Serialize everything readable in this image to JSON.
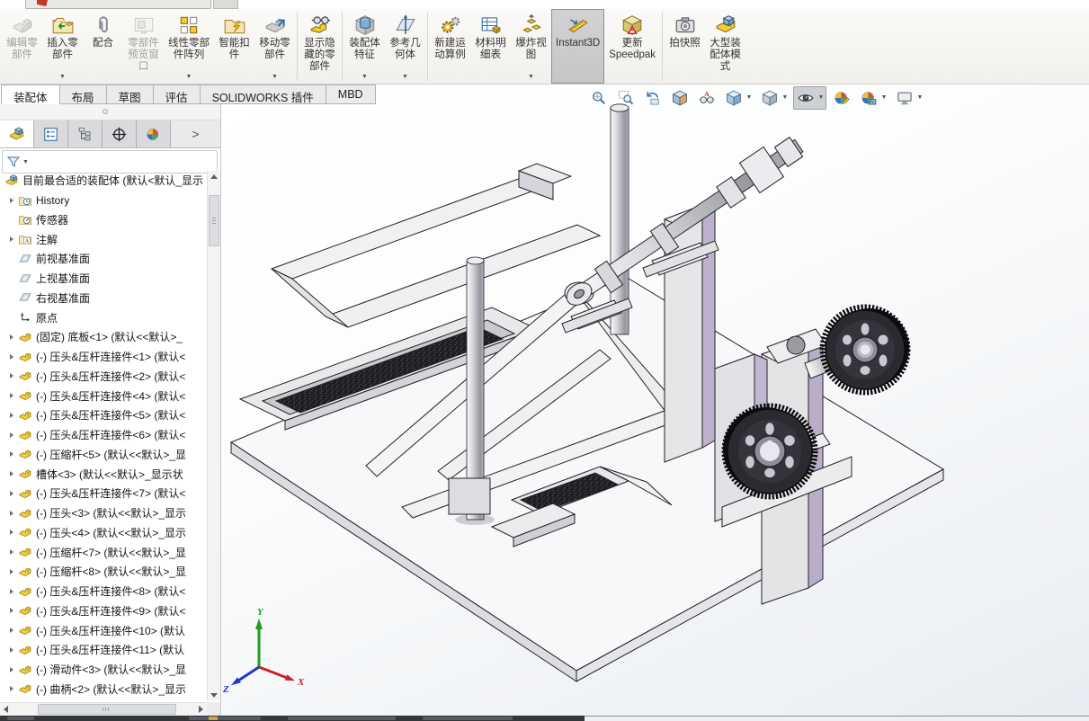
{
  "ribbon": {
    "items": [
      {
        "icon": "edit-component-icon",
        "label": "编辑零\n部件",
        "disabled": true
      },
      {
        "icon": "insert-component-icon",
        "label": "插入零\n部件",
        "dropdown": true
      },
      {
        "icon": "mate-icon",
        "label": "配合"
      },
      {
        "icon": "component-preview-icon",
        "label": "零部件\n预览窗\n口",
        "disabled": true
      },
      {
        "icon": "linear-pattern-icon",
        "label": "线性零部\n件阵列",
        "dropdown": true
      },
      {
        "icon": "smart-fasteners-icon",
        "label": "智能扣\n件"
      },
      {
        "icon": "move-component-icon",
        "label": "移动零\n部件",
        "dropdown": true
      },
      {
        "sep": true
      },
      {
        "icon": "show-hidden-components-icon",
        "label": "显示隐\n藏的零\n部件"
      },
      {
        "sep": true
      },
      {
        "icon": "assembly-features-icon",
        "label": "装配体\n特征",
        "dropdown": true
      },
      {
        "icon": "reference-geometry-icon",
        "label": "参考几\n何体",
        "dropdown": true
      },
      {
        "sep": true
      },
      {
        "icon": "motion-study-icon",
        "label": "新建运\n动算例"
      },
      {
        "icon": "bom-icon",
        "label": "材料明\n细表"
      },
      {
        "icon": "exploded-view-icon",
        "label": "爆炸视\n图",
        "dropdown": true
      },
      {
        "icon": "instant3d-icon",
        "label": "Instant3D",
        "active": true
      },
      {
        "icon": "update-speedpak-icon",
        "label": "更新\nSpeedpak"
      },
      {
        "sep": true
      },
      {
        "icon": "snapshot-icon",
        "label": "拍快照"
      },
      {
        "icon": "large-assembly-mode-icon",
        "label": "大型装\n配体模\n式"
      }
    ]
  },
  "tabs": {
    "items": [
      {
        "label": "装配体",
        "active": true
      },
      {
        "label": "布局"
      },
      {
        "label": "草图"
      },
      {
        "label": "评估"
      },
      {
        "label": "SOLIDWORKS 插件"
      },
      {
        "label": "MBD"
      }
    ]
  },
  "headsup": {
    "items": [
      {
        "icon": "zoom-fit-icon"
      },
      {
        "icon": "zoom-area-icon"
      },
      {
        "icon": "previous-view-icon"
      },
      {
        "icon": "section-view-icon"
      },
      {
        "icon": "view-annotations-icon"
      },
      {
        "icon": "view-orientation-icon",
        "dropdown": true
      },
      {
        "icon": "display-style-icon",
        "dropdown": true
      },
      {
        "icon": "hide-show-items-icon",
        "dropdown": true,
        "active": true
      },
      {
        "icon": "edit-appearance-icon"
      },
      {
        "icon": "apply-scene-icon",
        "dropdown": true
      },
      {
        "icon": "view-settings-icon",
        "dropdown": true
      }
    ]
  },
  "panel": {
    "tabs": [
      {
        "icon": "featuremanager-tab-icon",
        "active": true
      },
      {
        "icon": "propertymanager-tab-icon"
      },
      {
        "icon": "configurationmanager-tab-icon"
      },
      {
        "icon": "dimxpertmanager-tab-icon"
      },
      {
        "icon": "displaymanager-tab-icon"
      }
    ],
    "overflow_chevron": ">",
    "filter": {
      "icon": "filter-funnel-icon",
      "dropdown": true
    }
  },
  "tree": {
    "items": [
      {
        "icon": "assembly-icon",
        "label": "目前最合适的装配体 (默认<默认_显示",
        "arrow": false,
        "root": true
      },
      {
        "icon": "history-folder-icon",
        "label": "History",
        "arrow": true
      },
      {
        "icon": "sensors-folder-icon",
        "label": "传感器",
        "arrow": false
      },
      {
        "icon": "annotations-folder-icon",
        "label": "注解",
        "arrow": true
      },
      {
        "icon": "plane-icon",
        "label": "前视基准面",
        "arrow": false
      },
      {
        "icon": "plane-icon",
        "label": "上视基准面",
        "arrow": false
      },
      {
        "icon": "plane-icon",
        "label": "右视基准面",
        "arrow": false
      },
      {
        "icon": "origin-icon",
        "label": "原点",
        "arrow": false
      },
      {
        "icon": "part-icon",
        "label": "(固定) 底板<1> (默认<<默认>_",
        "arrow": true
      },
      {
        "icon": "part-icon",
        "label": "(-) 压头&压杆连接件<1> (默认<",
        "arrow": true
      },
      {
        "icon": "part-icon",
        "label": "(-) 压头&压杆连接件<2> (默认<",
        "arrow": true
      },
      {
        "icon": "part-icon",
        "label": "(-) 压头&压杆连接件<4> (默认<",
        "arrow": true
      },
      {
        "icon": "part-icon",
        "label": "(-) 压头&压杆连接件<5> (默认<",
        "arrow": true
      },
      {
        "icon": "part-icon",
        "label": "(-) 压头&压杆连接件<6> (默认<",
        "arrow": true
      },
      {
        "icon": "part-icon",
        "label": "(-) 压缩杆<5> (默认<<默认>_显",
        "arrow": true
      },
      {
        "icon": "part-icon",
        "label": "槽体<3> (默认<<默认>_显示状",
        "arrow": true
      },
      {
        "icon": "part-icon",
        "label": "(-) 压头&压杆连接件<7> (默认<",
        "arrow": true
      },
      {
        "icon": "part-icon",
        "label": "(-) 压头<3> (默认<<默认>_显示",
        "arrow": true
      },
      {
        "icon": "part-icon",
        "label": "(-) 压头<4> (默认<<默认>_显示",
        "arrow": true
      },
      {
        "icon": "part-icon",
        "label": "(-) 压缩杆<7> (默认<<默认>_显",
        "arrow": true
      },
      {
        "icon": "part-icon",
        "label": "(-) 压缩杆<8> (默认<<默认>_显",
        "arrow": true
      },
      {
        "icon": "part-icon",
        "label": "(-) 压头&压杆连接件<8> (默认<",
        "arrow": true
      },
      {
        "icon": "part-icon",
        "label": "(-) 压头&压杆连接件<9> (默认<",
        "arrow": true
      },
      {
        "icon": "part-icon",
        "label": "(-) 压头&压杆连接件<10> (默认",
        "arrow": true
      },
      {
        "icon": "part-icon",
        "label": "(-) 压头&压杆连接件<11> (默认",
        "arrow": true
      },
      {
        "icon": "part-icon",
        "label": "(-) 滑动件<3> (默认<<默认>_显",
        "arrow": true
      },
      {
        "icon": "part-icon",
        "label": "(-) 曲柄<2> (默认<<默认>_显示",
        "arrow": true
      }
    ]
  },
  "viewport": {
    "triad": {
      "x_label": "X",
      "y_label": "Y",
      "z_label": "Z"
    }
  },
  "colors": {
    "accent_blue": "#3a6ea5",
    "part_yellow": "#f2cf2e",
    "lavender": "#bdb1cc",
    "gear_dark": "#26262b",
    "instant3d_pressed_bg": "#cbcbcb",
    "viewport_top": "#ffffff",
    "viewport_bottom": "#e8ecf1",
    "triad_x": "#cc2222",
    "triad_y": "#1f9d1f",
    "triad_z": "#2233cc"
  }
}
